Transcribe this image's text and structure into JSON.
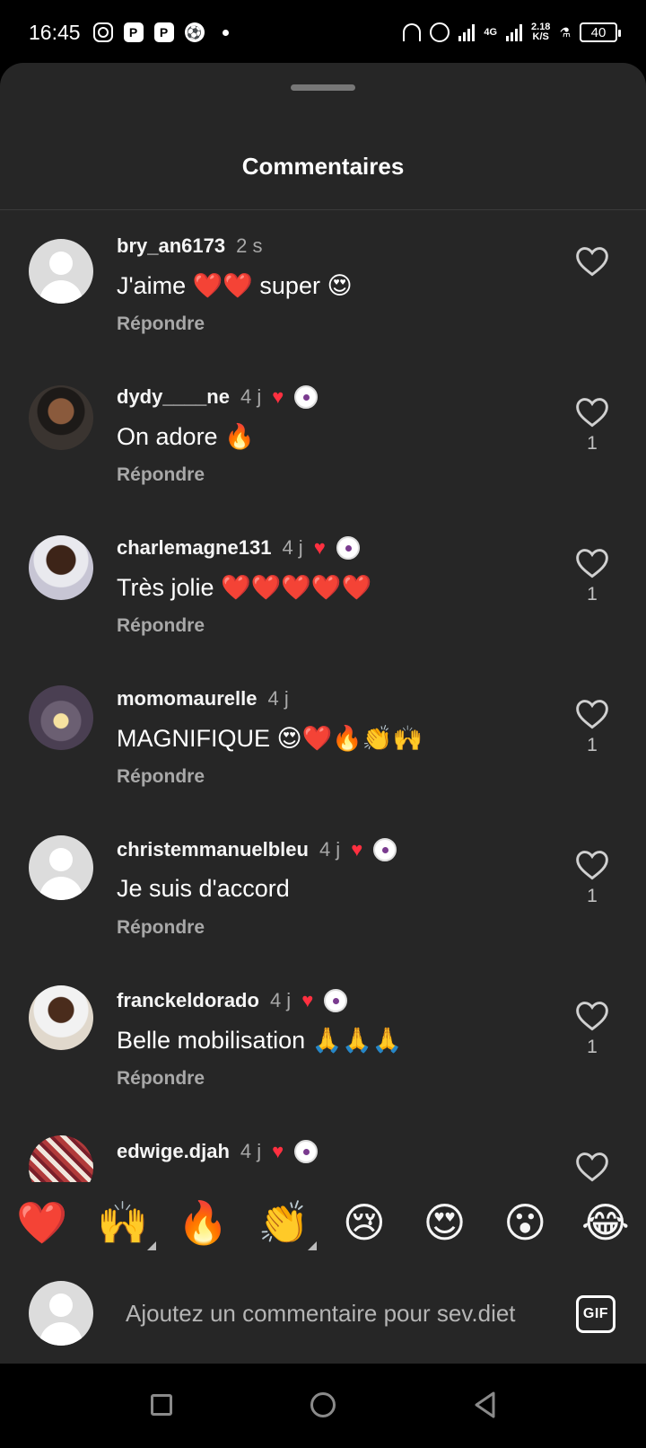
{
  "status_bar": {
    "time": "16:45",
    "network": "4G",
    "speed_value": "2.18",
    "speed_unit": "K/S",
    "battery": "40"
  },
  "sheet": {
    "title": "Commentaires"
  },
  "comments": [
    {
      "username": "bry_an6173",
      "time": "2 s",
      "text": "J'aime ❤️❤️ super 😍",
      "reply": "Répondre",
      "likes": "",
      "creator_liked": false,
      "avatar": "default"
    },
    {
      "username": "dydy____ne",
      "time": "4 j",
      "text": "On adore 🔥",
      "reply": "Répondre",
      "likes": "1",
      "creator_liked": true,
      "avatar": "p1"
    },
    {
      "username": "charlemagne131",
      "time": "4 j",
      "text": "Très jolie ❤️❤️❤️❤️❤️",
      "reply": "Répondre",
      "likes": "1",
      "creator_liked": true,
      "avatar": "p2"
    },
    {
      "username": "momomaurelle",
      "time": "4 j",
      "text": "MAGNIFIQUE 😍❤️🔥👏🙌",
      "reply": "Répondre",
      "likes": "1",
      "creator_liked": false,
      "avatar": "p3"
    },
    {
      "username": "christemmanuelbleu",
      "time": "4 j",
      "text": "Je suis d'accord",
      "reply": "Répondre",
      "likes": "1",
      "creator_liked": true,
      "avatar": "default"
    },
    {
      "username": "franckeldorado",
      "time": "4 j",
      "text": "Belle mobilisation 🙏🙏🙏",
      "reply": "Répondre",
      "likes": "1",
      "creator_liked": true,
      "avatar": "p4"
    },
    {
      "username": "edwige.djah",
      "time": "4 j",
      "text": "",
      "reply": "",
      "likes": "",
      "creator_liked": true,
      "avatar": "p5"
    }
  ],
  "quick_reactions": [
    "❤️",
    "🙌",
    "🔥",
    "👏",
    "😢",
    "😍",
    "😮",
    "😂"
  ],
  "composer": {
    "placeholder": "Ajoutez un commentaire pour sev.diet",
    "gif_label": "GIF"
  },
  "colors": {
    "sheet_bg": "#262626",
    "like_red": "#ff3040",
    "muted_text": "#a8a8a8"
  }
}
